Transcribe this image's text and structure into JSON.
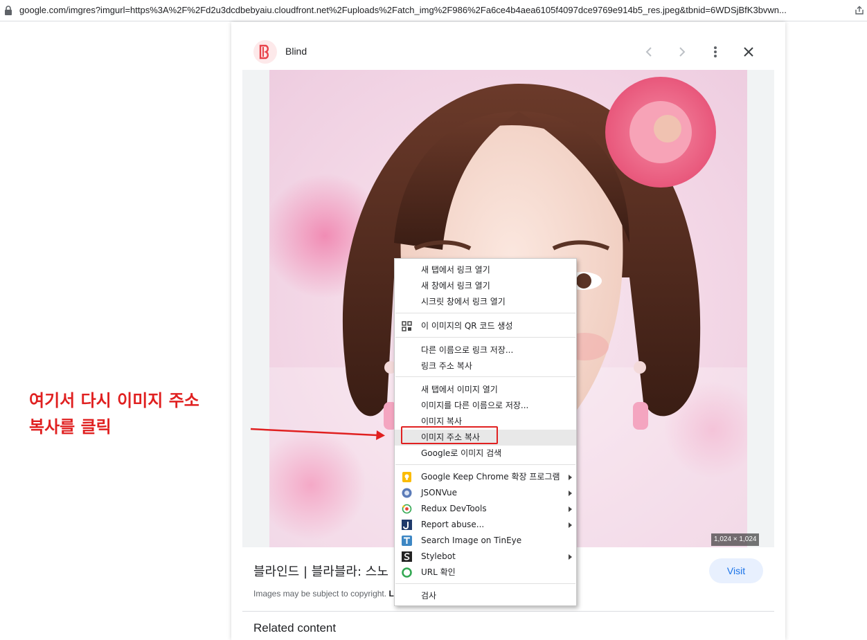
{
  "browser": {
    "url": "google.com/imgres?imgurl=https%3A%2F%2Fd2u3dcdbebyaiu.cloudfront.net%2Fuploads%2Fatch_img%2F986%2Fa6ce4b4aea6105f4097dce9769e914b5_res.jpeg&tbnid=6WDSjBfK3bvwn..."
  },
  "panel": {
    "site_name": "Blind",
    "dimensions": "1,024 × 1,024",
    "image_title": "블라인드 | 블라블라: 스노",
    "visit_label": "Visit",
    "copyright_text": "Images may be subject to copyright.",
    "copyright_link": "L",
    "related_heading": "Related content"
  },
  "context_menu": {
    "group1": [
      "새 탭에서 링크 열기",
      "새 창에서 링크 열기",
      "시크릿 창에서 링크 열기"
    ],
    "qr": "이 이미지의 QR 코드 생성",
    "group2": [
      "다른 이름으로 링크 저장...",
      "링크 주소 복사"
    ],
    "group3": [
      "새 탭에서 이미지 열기",
      "이미지를 다른 이름으로 저장...",
      "이미지 복사",
      "이미지 주소 복사",
      "Google로 이미지 검색"
    ],
    "extensions": [
      {
        "label": "Google Keep Chrome 확장 프로그램",
        "icon": "keep-icon",
        "submenu": true
      },
      {
        "label": "JSONVue",
        "icon": "jsonvue-icon",
        "submenu": true
      },
      {
        "label": "Redux DevTools",
        "icon": "redux-icon",
        "submenu": true
      },
      {
        "label": "Report abuse...",
        "icon": "report-icon",
        "submenu": true
      },
      {
        "label": "Search Image on TinEye",
        "icon": "tineye-icon",
        "submenu": false
      },
      {
        "label": "Stylebot",
        "icon": "stylebot-icon",
        "submenu": true
      },
      {
        "label": "URL 확인",
        "icon": "url-check-icon",
        "submenu": false
      }
    ],
    "inspect": "검사",
    "highlighted_item": "이미지 주소 복사"
  },
  "annotation": {
    "line1": "여기서 다시 이미지 주소",
    "line2": "복사를 클릭"
  },
  "colors": {
    "annotation_red": "#e02020",
    "visit_bg": "#e8f0fe",
    "visit_text": "#1a73e8"
  }
}
